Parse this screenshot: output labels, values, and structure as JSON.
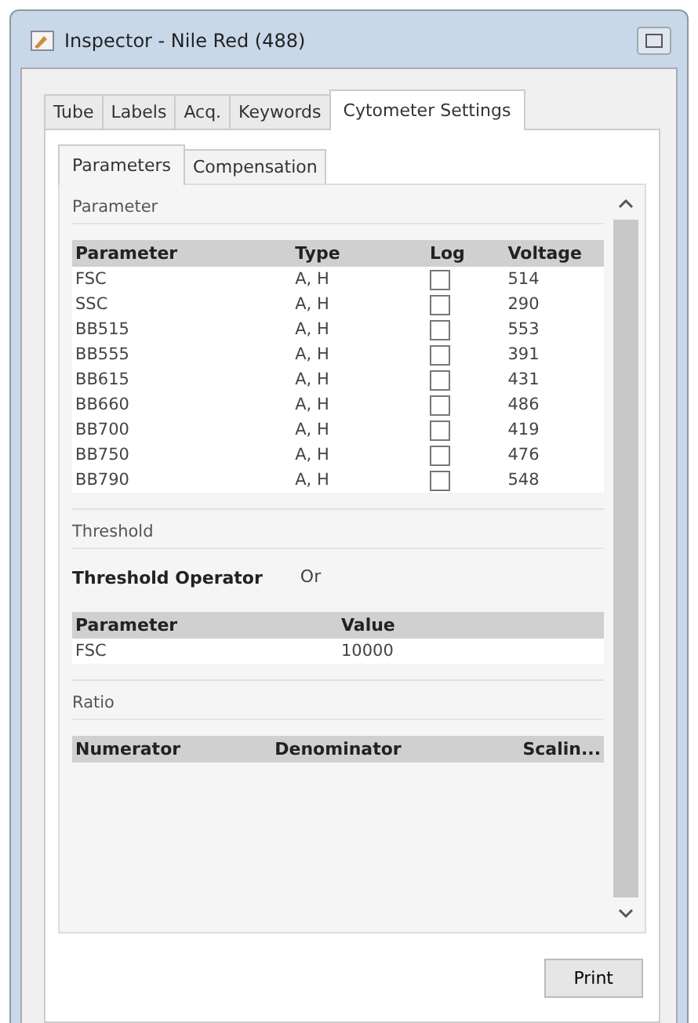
{
  "window": {
    "title": "Inspector - Nile Red (488)"
  },
  "tabs": [
    {
      "label": "Tube",
      "selected": false
    },
    {
      "label": "Labels",
      "selected": false
    },
    {
      "label": "Acq.",
      "selected": false
    },
    {
      "label": "Keywords",
      "selected": false
    },
    {
      "label": "Cytometer Settings",
      "selected": true
    }
  ],
  "subtabs": [
    {
      "label": "Parameters",
      "selected": true
    },
    {
      "label": "Compensation",
      "selected": false
    }
  ],
  "parameter_group": {
    "title": "Parameter",
    "columns": [
      "Parameter",
      "Type",
      "Log",
      "Voltage"
    ],
    "rows": [
      {
        "name": "FSC",
        "type": "A, H",
        "log": false,
        "voltage": "514"
      },
      {
        "name": "SSC",
        "type": "A, H",
        "log": false,
        "voltage": "290"
      },
      {
        "name": "BB515",
        "type": "A, H",
        "log": false,
        "voltage": "553"
      },
      {
        "name": "BB555",
        "type": "A, H",
        "log": false,
        "voltage": "391"
      },
      {
        "name": "BB615",
        "type": "A, H",
        "log": false,
        "voltage": "431"
      },
      {
        "name": "BB660",
        "type": "A, H",
        "log": false,
        "voltage": "486"
      },
      {
        "name": "BB700",
        "type": "A, H",
        "log": false,
        "voltage": "419"
      },
      {
        "name": "BB750",
        "type": "A, H",
        "log": false,
        "voltage": "476"
      },
      {
        "name": "BB790",
        "type": "A, H",
        "log": false,
        "voltage": "548"
      }
    ]
  },
  "threshold_group": {
    "title": "Threshold",
    "operator_label": "Threshold Operator",
    "operator_value": "Or",
    "columns": [
      "Parameter",
      "Value"
    ],
    "rows": [
      {
        "parameter": "FSC",
        "value": "10000"
      }
    ]
  },
  "ratio_group": {
    "title": "Ratio",
    "columns": [
      "Numerator",
      "Denominator",
      "Scalin..."
    ]
  },
  "buttons": [
    "Print"
  ]
}
